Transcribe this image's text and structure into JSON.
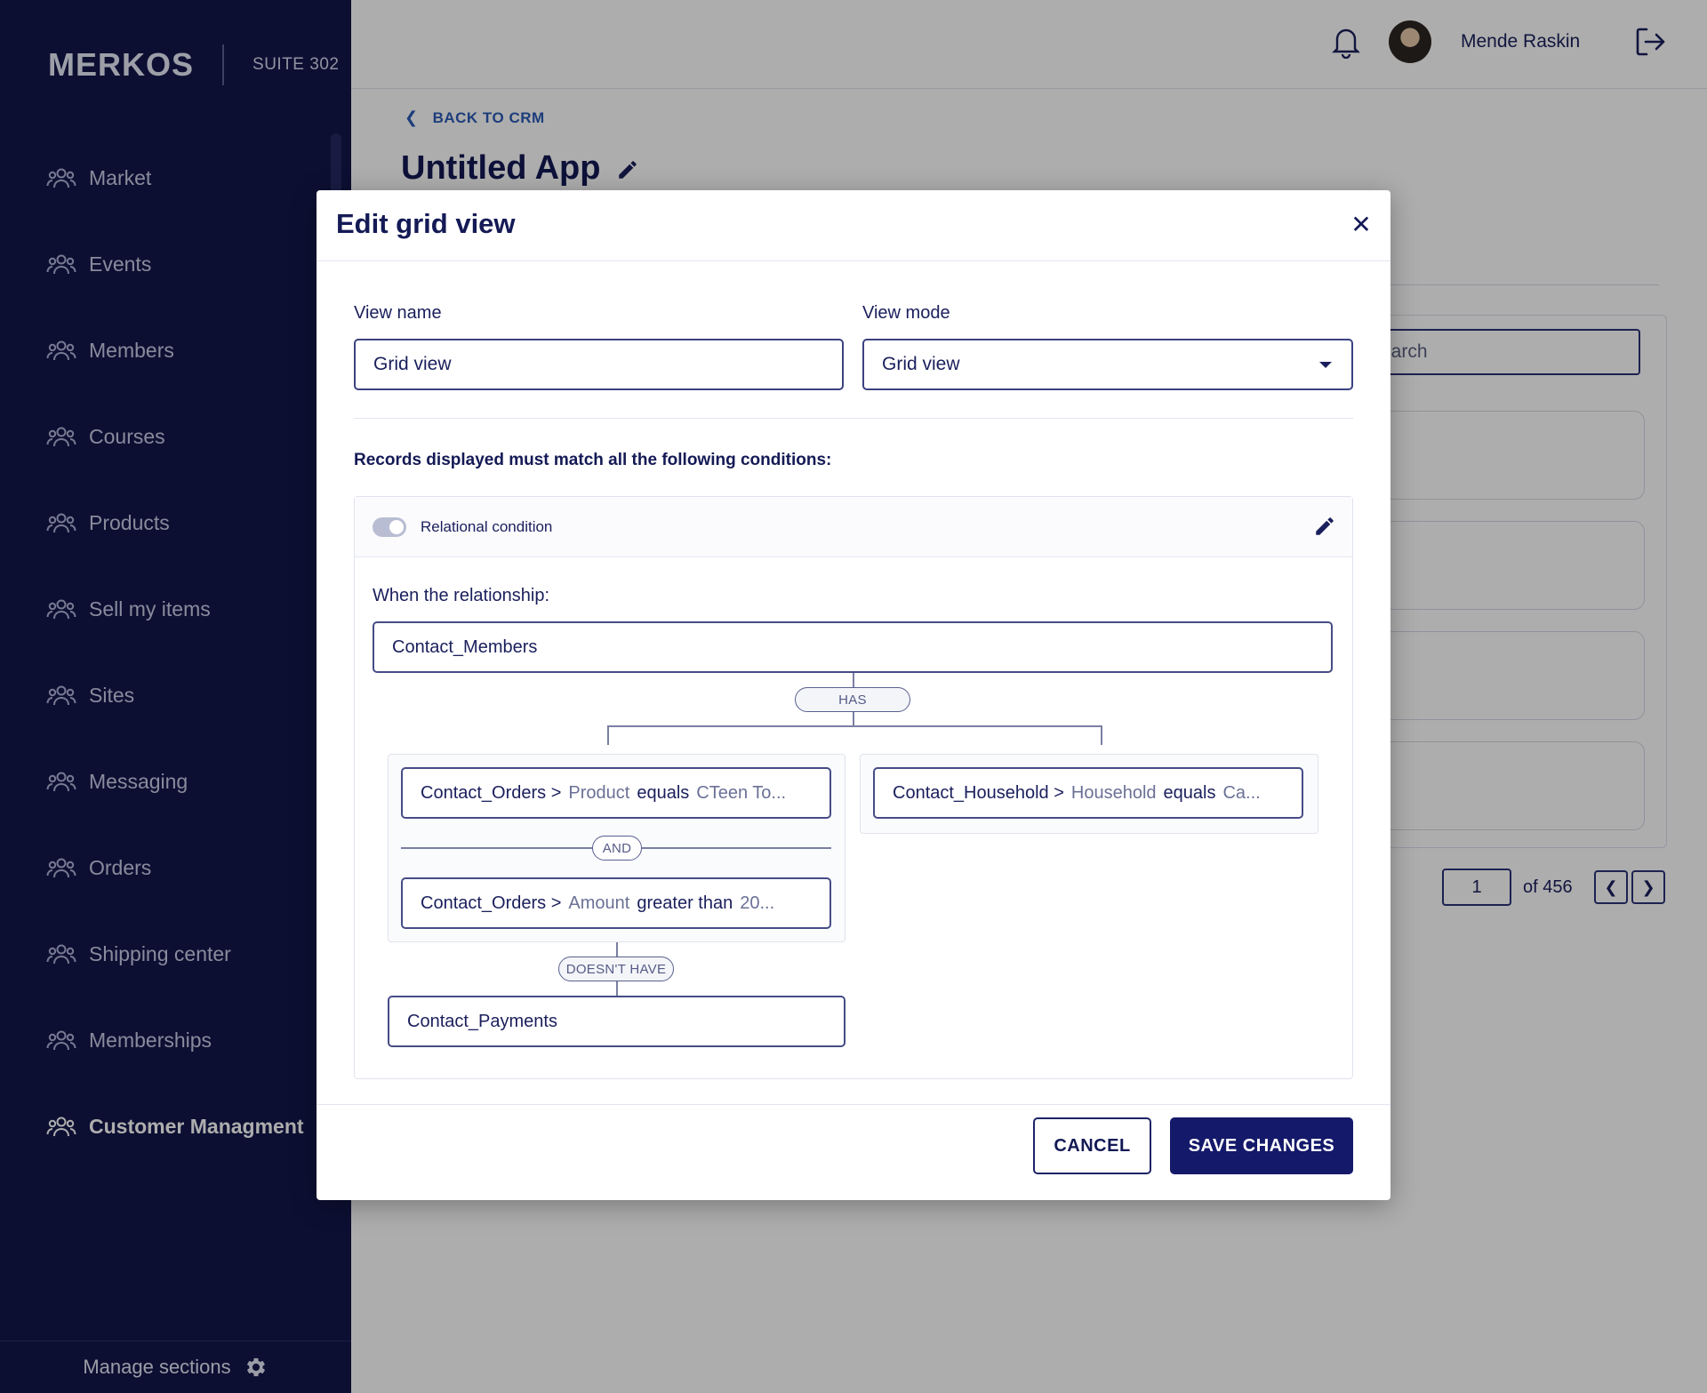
{
  "brand": {
    "name": "MERKOS",
    "suite": "SUITE 302"
  },
  "sidebar": {
    "items": [
      {
        "label": "Market"
      },
      {
        "label": "Events"
      },
      {
        "label": "Members"
      },
      {
        "label": "Courses"
      },
      {
        "label": "Products"
      },
      {
        "label": "Sell my items"
      },
      {
        "label": "Sites"
      },
      {
        "label": "Messaging"
      },
      {
        "label": "Orders"
      },
      {
        "label": "Shipping center"
      },
      {
        "label": "Memberships"
      },
      {
        "label": "Customer Managment"
      }
    ],
    "manage_label": "Manage sections"
  },
  "header": {
    "user_name": "Mende Raskin"
  },
  "page": {
    "back_label": "BACK TO CRM",
    "title": "Untitled App",
    "search_placeholder": "earch",
    "pager": {
      "current": "1",
      "of_label": "of 456"
    }
  },
  "modal": {
    "title": "Edit grid view",
    "view_name_label": "View name",
    "view_name_value": "Grid view",
    "view_mode_label": "View mode",
    "view_mode_value": "Grid view",
    "conditions_heading": "Records displayed must match all the following conditions:",
    "relational_condition_label": "Relational condition",
    "when_label": "When the relationship:",
    "relationship": "Contact_Members",
    "has_label": "HAS",
    "and_label": "AND",
    "doesnt_have_label": "DOESN'T HAVE",
    "conditions": [
      {
        "prefix": "Contact_Orders >",
        "field": "Product",
        "operator": "equals",
        "value": "CTeen To..."
      },
      {
        "prefix": "Contact_Orders >",
        "field": "Amount",
        "operator": "greater than",
        "value": "20..."
      },
      {
        "prefix": "Contact_Household >",
        "field": "Household",
        "operator": "equals",
        "value": "Ca..."
      }
    ],
    "excluded_relationship": "Contact_Payments",
    "cancel_label": "CANCEL",
    "save_label": "SAVE CHANGES"
  },
  "colors": {
    "sidebar_bg": "#12174a",
    "primary": "#15196a",
    "link": "#2b5bb5"
  }
}
